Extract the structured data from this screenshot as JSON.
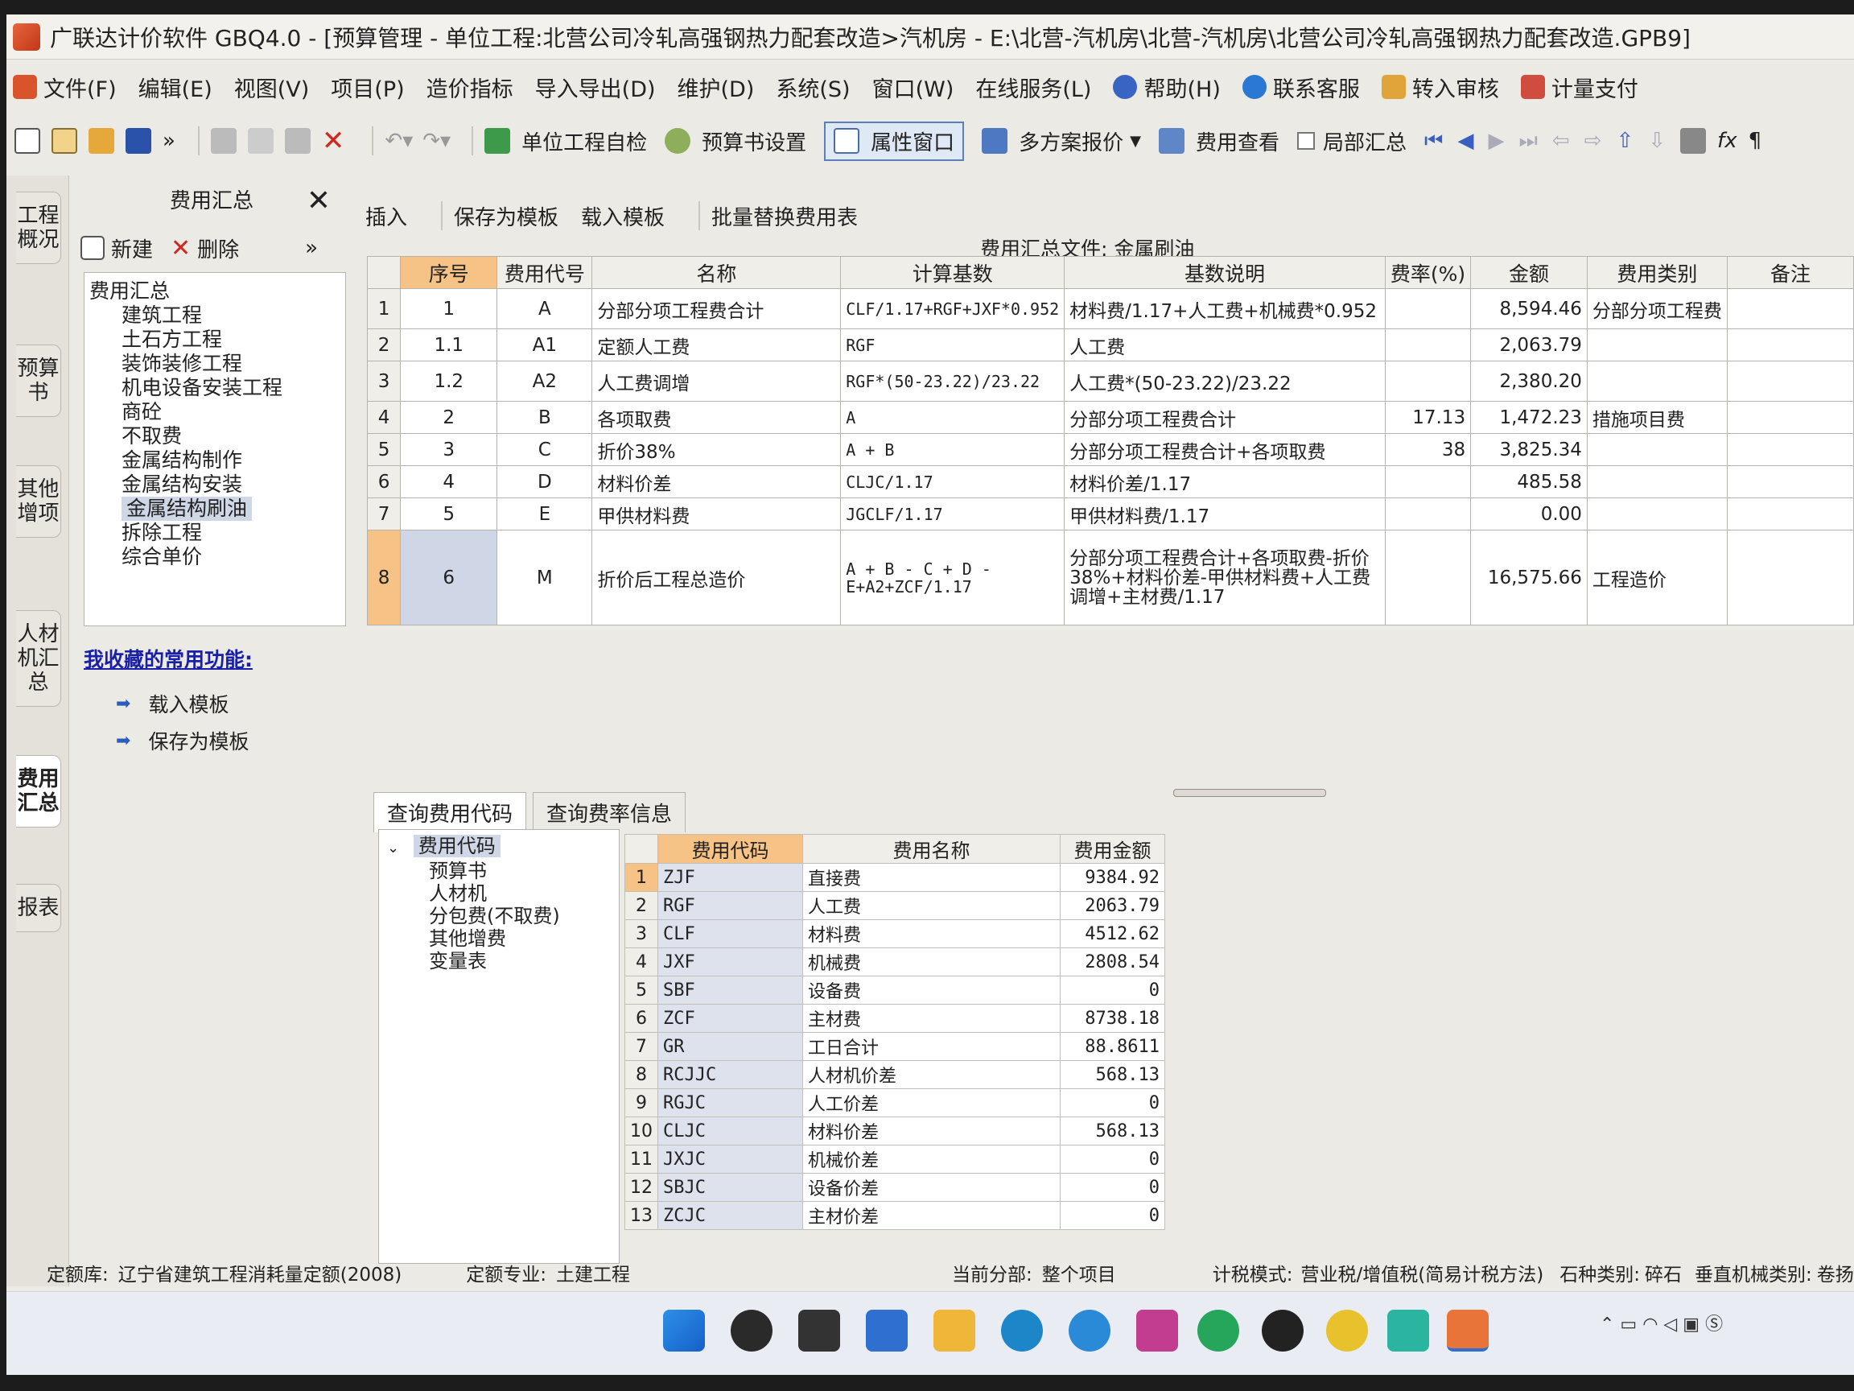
{
  "window": {
    "title": "广联达计价软件 GBQ4.0 - [预算管理 - 单位工程:北营公司冷轧高强钢热力配套改造>汽机房 - E:\\北营-汽机房\\北营-汽机房\\北营公司冷轧高强钢热力配套改造.GPB9]"
  },
  "menu": {
    "items": [
      "文件(F)",
      "编辑(E)",
      "视图(V)",
      "项目(P)",
      "造价指标",
      "导入导出(D)",
      "维护(D)",
      "系统(S)",
      "窗口(W)",
      "在线服务(L)"
    ],
    "help": "帮助(H)",
    "contact": "联系客服",
    "review": "转入审核",
    "pay": "计量支付"
  },
  "toolbar": {
    "self_check": "单位工程自检",
    "budget_settings": "预算书设置",
    "property_window": "属性窗口",
    "multi_quote": "多方案报价",
    "fee_view": "费用查看",
    "local_summary": "局部汇总"
  },
  "left_tabs": [
    "工程概况",
    "预算书",
    "其他增项",
    "人材机汇总",
    "费用汇总",
    "报表"
  ],
  "sidebar": {
    "title": "费用汇总",
    "new_label": "新建",
    "delete_label": "删除",
    "tree_root": "费用汇总",
    "tree_items": [
      "建筑工程",
      "土石方工程",
      "装饰装修工程",
      "机电设备安装工程",
      "商砼",
      "不取费",
      "金属结构制作",
      "金属结构安装",
      "金属结构刷油",
      "拆除工程",
      "综合单价"
    ],
    "selected_item": "金属结构刷油",
    "favorites_title": "我收藏的常用功能:",
    "favorites": [
      "载入模板",
      "保存为模板"
    ]
  },
  "subtoolbar": {
    "insert": "插入",
    "save_template": "保存为模板",
    "load_template": "载入模板",
    "batch_replace": "批量替换费用表",
    "file_label": "费用汇总文件: 金属刷油"
  },
  "fee_table": {
    "headers": [
      "序号",
      "费用代号",
      "名称",
      "计算基数",
      "基数说明",
      "费率(%)",
      "金额",
      "费用类别",
      "备注"
    ],
    "rows": [
      {
        "rn": "1",
        "seq": "1",
        "code": "A",
        "name": "分部分项工程费合计",
        "base": "CLF/1.17+RGF+JXF*0.952",
        "desc": "材料费/1.17+人工费+机械费*0.952",
        "rate": "",
        "amount": "8,594.46",
        "category": "分部分项工程费",
        "note": ""
      },
      {
        "rn": "2",
        "seq": "1.1",
        "code": "A1",
        "name": "定额人工费",
        "base": "RGF",
        "desc": "人工费",
        "rate": "",
        "amount": "2,063.79",
        "category": "",
        "note": ""
      },
      {
        "rn": "3",
        "seq": "1.2",
        "code": "A2",
        "name": "人工费调增",
        "base": "RGF*(50-23.22)/23.22",
        "desc": "人工费*(50-23.22)/23.22",
        "rate": "",
        "amount": "2,380.20",
        "category": "",
        "note": ""
      },
      {
        "rn": "4",
        "seq": "2",
        "code": "B",
        "name": "各项取费",
        "base": "A",
        "desc": "分部分项工程费合计",
        "rate": "17.13",
        "amount": "1,472.23",
        "category": "措施项目费",
        "note": ""
      },
      {
        "rn": "5",
        "seq": "3",
        "code": "C",
        "name": "折价38%",
        "base": "A + B",
        "desc": "分部分项工程费合计+各项取费",
        "rate": "38",
        "amount": "3,825.34",
        "category": "",
        "note": ""
      },
      {
        "rn": "6",
        "seq": "4",
        "code": "D",
        "name": "材料价差",
        "base": "CLJC/1.17",
        "desc": "材料价差/1.17",
        "rate": "",
        "amount": "485.58",
        "category": "",
        "note": ""
      },
      {
        "rn": "7",
        "seq": "5",
        "code": "E",
        "name": "甲供材料费",
        "base": "JGCLF/1.17",
        "desc": "甲供材料费/1.17",
        "rate": "",
        "amount": "0.00",
        "category": "",
        "note": ""
      },
      {
        "rn": "8",
        "seq": "6",
        "code": "M",
        "name": "折价后工程总造价",
        "base": "A + B - C + D - E+A2+ZCF/1.17",
        "desc": "分部分项工程费合计+各项取费-折价38%+材料价差-甲供材料费+人工费调增+主材费/1.17",
        "rate": "",
        "amount": "16,575.66",
        "category": "工程造价",
        "note": ""
      }
    ]
  },
  "bottom_tabs": [
    "查询费用代码",
    "查询费率信息"
  ],
  "code_tree": {
    "root": "费用代码",
    "children": [
      "预算书",
      "人材机",
      "分包费(不取费)",
      "其他增费",
      "变量表"
    ]
  },
  "code_table": {
    "headers": [
      "费用代码",
      "费用名称",
      "费用金额"
    ],
    "rows": [
      {
        "rn": "1",
        "code": "ZJF",
        "name": "直接费",
        "amount": "9384.92"
      },
      {
        "rn": "2",
        "code": "RGF",
        "name": "人工费",
        "amount": "2063.79"
      },
      {
        "rn": "3",
        "code": "CLF",
        "name": "材料费",
        "amount": "4512.62"
      },
      {
        "rn": "4",
        "code": "JXF",
        "name": "机械费",
        "amount": "2808.54"
      },
      {
        "rn": "5",
        "code": "SBF",
        "name": "设备费",
        "amount": "0"
      },
      {
        "rn": "6",
        "code": "ZCF",
        "name": "主材费",
        "amount": "8738.18"
      },
      {
        "rn": "7",
        "code": "GR",
        "name": "工日合计",
        "amount": "88.8611"
      },
      {
        "rn": "8",
        "code": "RCJJC",
        "name": "人材机价差",
        "amount": "568.13"
      },
      {
        "rn": "9",
        "code": "RGJC",
        "name": "人工价差",
        "amount": "0"
      },
      {
        "rn": "10",
        "code": "CLJC",
        "name": "材料价差",
        "amount": "568.13"
      },
      {
        "rn": "11",
        "code": "JXJC",
        "name": "机械价差",
        "amount": "0"
      },
      {
        "rn": "12",
        "code": "SBJC",
        "name": "设备价差",
        "amount": "0"
      },
      {
        "rn": "13",
        "code": "ZCJC",
        "name": "主材价差",
        "amount": "0"
      }
    ]
  },
  "status": {
    "quota_lib_label": "定额库:",
    "quota_lib": "辽宁省建筑工程消耗量定额(2008)",
    "quota_major_label": "定额专业:",
    "quota_major": "土建工程",
    "current_part_label": "当前分部:",
    "current_part": "整个项目",
    "tax_mode_label": "计税模式:",
    "tax_mode": "营业税/增值税(简易计税方法)",
    "stone_label": "石种类别:",
    "stone": "碎石",
    "vertical_label": "垂直机械类别:",
    "vertical": "卷扬机"
  },
  "colors": {
    "header_highlight": "#f6c285",
    "selection": "#cfd6e6",
    "favorites_link": "#1a1fa8"
  }
}
